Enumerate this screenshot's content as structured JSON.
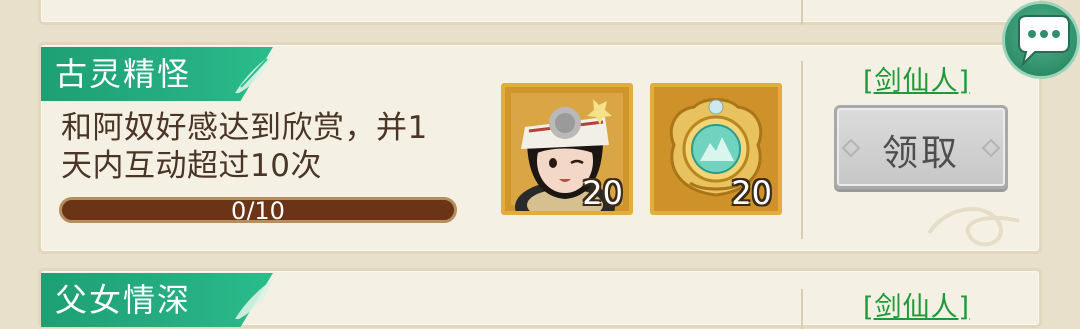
{
  "quests": [
    {
      "title": "古灵精怪",
      "description_line1": "和阿奴好感达到欣赏，并1",
      "description_line2": "天内互动超过10次",
      "progress_text": "0/10",
      "progress_fraction": 0,
      "source_link": "[剑仙人]",
      "claim_button": "领取",
      "rewards": [
        {
          "icon": "character-portrait-anu",
          "count": "20"
        },
        {
          "icon": "jade-medallion-icon",
          "count": "20"
        }
      ]
    },
    {
      "title": "父女情深",
      "source_link": "[剑仙人]"
    }
  ],
  "colors": {
    "title_tab": "#1e9f74",
    "progress_track": "#6c3416",
    "source_link": "#1e9a3a",
    "claim_button_disabled": "#c6c6c6",
    "reward_frame": "#e3ad3c",
    "chat_button": "#2f8f6a"
  },
  "chat_button": {
    "icon": "chat-bubble-icon"
  }
}
